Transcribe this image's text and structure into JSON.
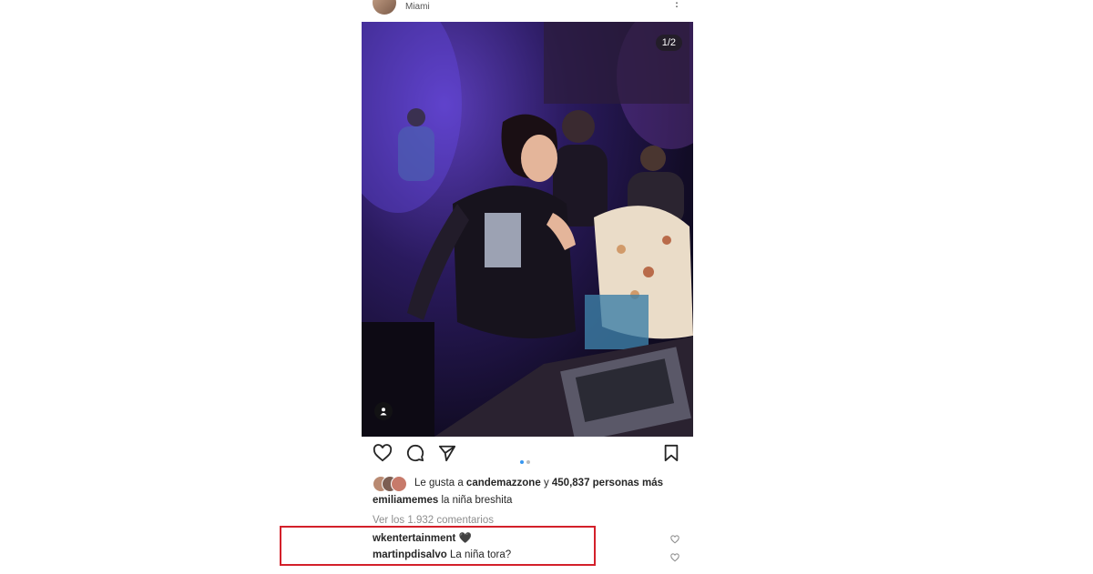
{
  "post": {
    "location": "Miami",
    "image_counter": "1/2",
    "colors": {
      "highlight_border": "#d3202a",
      "active_dot": "#3897f0"
    },
    "icons": [
      "more-icon",
      "heart-icon",
      "comment-icon",
      "share-icon",
      "bookmark-icon",
      "tag-person-icon"
    ],
    "likes": {
      "prefix": "Le gusta a",
      "user": "candemazzone",
      "joiner": "y",
      "count": "450,837 personas más"
    },
    "caption": {
      "user": "emiliamemes",
      "text": "la niña breshita"
    },
    "view_comments": "Ver los 1.932 comentarios",
    "comments": [
      {
        "user": "wkentertainment",
        "text": "🖤"
      },
      {
        "user": "martinpdisalvo",
        "text": "La niña tora?"
      }
    ]
  }
}
